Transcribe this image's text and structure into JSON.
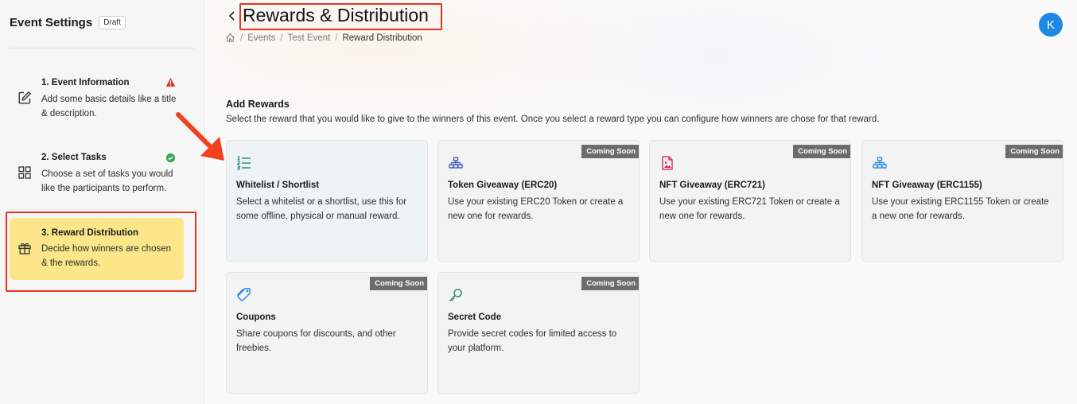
{
  "sidebar": {
    "title": "Event Settings",
    "badge": "Draft",
    "steps": [
      {
        "name": "1. Event Information",
        "desc": "Add some basic details like a title & description.",
        "icon": "edit-icon",
        "status": "warning"
      },
      {
        "name": "2. Select Tasks",
        "desc": "Choose a set of tasks you would like the participants to perform.",
        "icon": "grid-icon",
        "status": "complete"
      },
      {
        "name": "3. Reward Distribution",
        "desc": "Decide how winners are chosen & the rewards.",
        "icon": "gift-icon",
        "status": "active"
      }
    ]
  },
  "header": {
    "title": "Rewards & Distribution",
    "breadcrumb": [
      "Events",
      "Test Event",
      "Reward Distribution"
    ],
    "avatar_initial": "K"
  },
  "rewards": {
    "title": "Add Rewards",
    "subtitle": "Select the reward that you would like to give to the winners of this event. Once you select a reward type you can configure how winners are chose for that reward.",
    "badge": "Coming Soon",
    "cards": [
      {
        "title": "Whitelist / Shortlist",
        "desc": "Select a whitelist or a shortlist, use this for some offline, physical or manual reward.",
        "icon": "list-icon",
        "coming_soon": false
      },
      {
        "title": "Token Giveaway (ERC20)",
        "desc": "Use your existing ERC20 Token or create a new one for rewards.",
        "icon": "hierarchy-icon",
        "coming_soon": true
      },
      {
        "title": "NFT Giveaway (ERC721)",
        "desc": "Use your existing ERC721 Token or create a new one for rewards.",
        "icon": "image-file-icon",
        "coming_soon": true
      },
      {
        "title": "NFT Giveaway (ERC1155)",
        "desc": "Use your existing ERC1155 Token or create a new one for rewards.",
        "icon": "hierarchy-icon",
        "coming_soon": true
      },
      {
        "title": "Coupons",
        "desc": "Share coupons for discounts, and other freebies.",
        "icon": "tag-icon",
        "coming_soon": true
      },
      {
        "title": "Secret Code",
        "desc": "Provide secret codes for limited access to your platform.",
        "icon": "key-icon",
        "coming_soon": true
      }
    ]
  },
  "colors": {
    "active_step_bg": "#fde68a",
    "highlight_red": "#e5341f",
    "avatar_bg": "#1e88e5",
    "badge_bg": "#6c6c6c",
    "warning": "#d93025",
    "success": "#34a853"
  }
}
